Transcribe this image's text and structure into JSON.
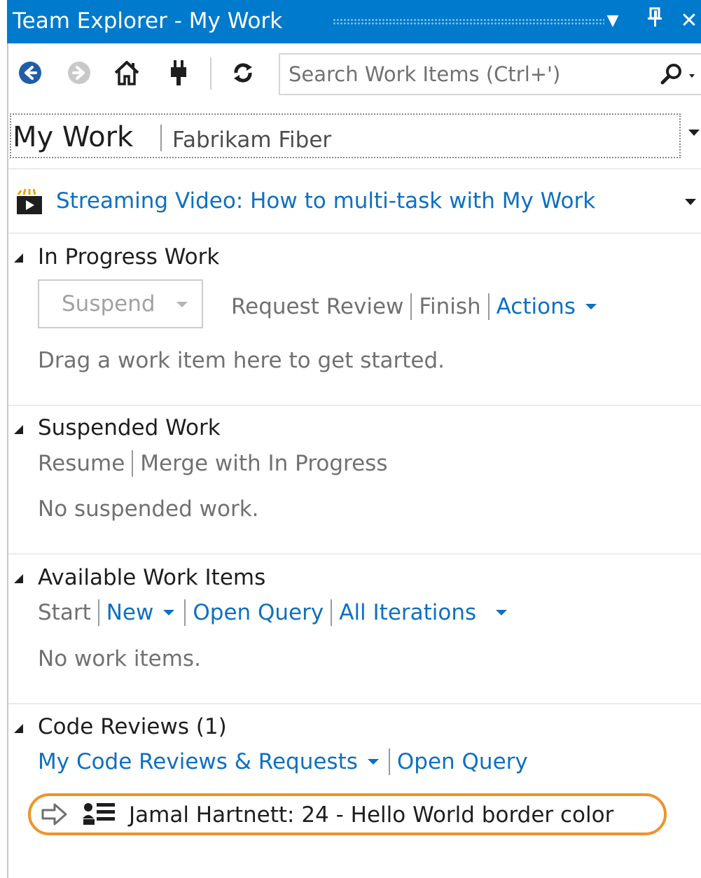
{
  "window": {
    "title": "Team Explorer - My Work",
    "controls": {
      "dropdown": "▼",
      "pin": "ᵽ",
      "close": "✕"
    }
  },
  "toolbar": {
    "icons": [
      "back-icon",
      "forward-icon",
      "home-icon",
      "connect-icon",
      "refresh-icon"
    ],
    "search": {
      "placeholder": "Search Work Items (Ctrl+')",
      "value": ""
    }
  },
  "page": {
    "title": "My Work",
    "subtitle": "Fabrikam Fiber"
  },
  "video": {
    "link": "Streaming Video: How to multi-task with My Work"
  },
  "sections": {
    "in_progress": {
      "title": "In Progress Work",
      "suspend_label": "Suspend",
      "actions": [
        "Request Review",
        "Finish",
        "Actions"
      ],
      "message": "Drag a work item here to get started."
    },
    "suspended": {
      "title": "Suspended Work",
      "actions": [
        "Resume",
        "Merge with In Progress"
      ],
      "message": "No suspended work."
    },
    "available": {
      "title": "Available Work Items",
      "actions": [
        "Start",
        "New",
        "Open Query",
        "All Iterations"
      ],
      "message": "No work items."
    },
    "code_reviews": {
      "title": "Code Reviews (1)",
      "actions": [
        "My Code Reviews & Requests",
        "Open Query"
      ],
      "items": [
        {
          "text": "Jamal Hartnett: 24 - Hello World border color"
        }
      ]
    }
  },
  "colors": {
    "titlebar": "#007acc",
    "link": "#0e70c0",
    "highlight": "#f0922b"
  }
}
